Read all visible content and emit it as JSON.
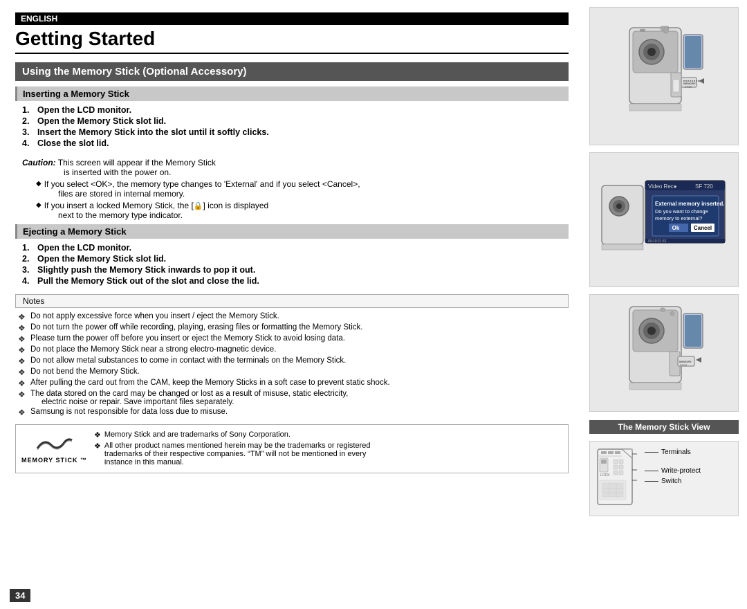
{
  "english_badge": "ENGLISH",
  "page_title": "Getting Started",
  "section_title": "Using the Memory Stick (Optional Accessory)",
  "inserting_header": "Inserting a Memory Stick",
  "inserting_steps": [
    {
      "num": "1.",
      "text": "Open the LCD monitor."
    },
    {
      "num": "2.",
      "text": "Open the Memory Stick slot lid."
    },
    {
      "num": "3.",
      "text": "Insert the Memory Stick into the slot until it softly clicks."
    },
    {
      "num": "4.",
      "text": "Close the slot lid."
    }
  ],
  "caution_label": "Caution:",
  "caution_text": " This screen will appear if the Memory Stick",
  "caution_text2": "is inserted with the power on.",
  "bullet1": "If you select <OK>, the memory type changes to 'External' and if you select <Cancel>,",
  "bullet1b": "files are stored in internal memory.",
  "bullet2": "If you insert a locked Memory Stick, the [",
  "bullet2b": "] icon is displayed",
  "bullet2c": "next to the memory type indicator.",
  "ejecting_header": "Ejecting a Memory Stick",
  "ejecting_steps": [
    {
      "num": "1.",
      "text": "Open the LCD monitor."
    },
    {
      "num": "2.",
      "text": "Open the Memory Stick slot lid."
    },
    {
      "num": "3.",
      "text": "Slightly push the Memory Stick inwards to pop it out."
    },
    {
      "num": "4.",
      "text": "Pull the Memory Stick out of the slot and close the lid."
    }
  ],
  "notes_label": "Notes",
  "notes_items": [
    "Do not apply excessive force when you insert / eject the Memory Stick.",
    "Do not turn the power off while recording, playing, erasing files or formatting the Memory Stick.",
    "Please turn the power off before you insert or eject the Memory Stick to avoid losing data.",
    "Do not place the Memory Stick near a strong electro-magnetic device.",
    "Do not allow metal substances to come in contact with the terminals on the Memory Stick.",
    "Do not bend the Memory Stick.",
    "After pulling the card out from the CAM, keep the Memory Sticks in a soft case to prevent static shock.",
    "The data stored on the card may be changed or lost as a result of misuse, static electricity,",
    "electric noise or repair. Save important files separately.",
    "Samsung is not responsible for data loss due to misuse."
  ],
  "trademark_bullet1": "Memory Stick and        are trademarks of Sony Corporation.",
  "trademark_bullet2": "All other product names mentioned herein may be the trademarks or registered",
  "trademark_bullet3": "trademarks of their respective companies. “TM” will not be mentioned in every",
  "trademark_bullet4": "instance in this manual.",
  "trademark_name": "Memory Stick ™",
  "page_number": "34",
  "screen_top": "Video Rec●  SF  720",
  "screen_msg1": "External memory inserted.",
  "screen_msg2": "Do you want to change",
  "screen_msg3": "memory to external?",
  "screen_ok": "Ok",
  "screen_cancel": "Cancel",
  "memory_stick_view_label": "The Memory Stick View",
  "ms_terminals_label": "Terminals",
  "ms_writeprotect_label": "Write-protect",
  "ms_switch_label": "Switch"
}
